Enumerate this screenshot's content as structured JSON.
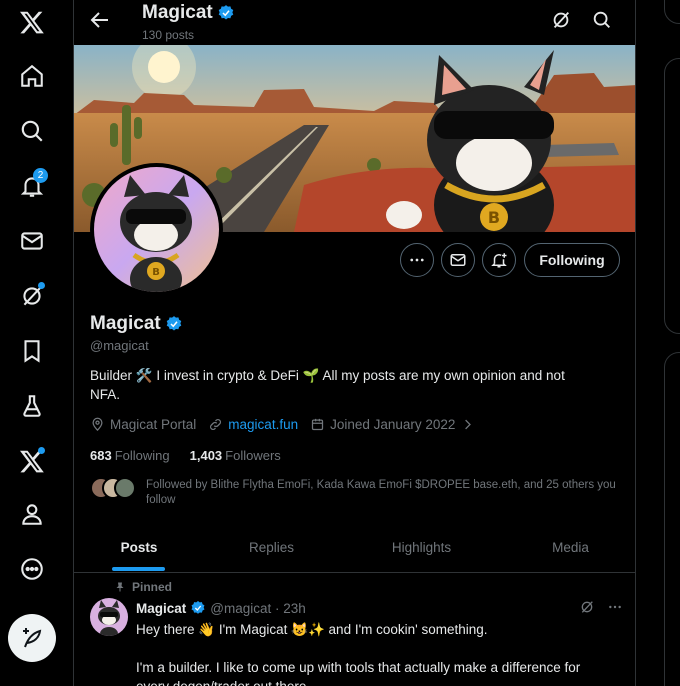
{
  "nav": {
    "notifications_badge": "2"
  },
  "header": {
    "name": "Magicat",
    "post_count": "130 posts"
  },
  "profile": {
    "name": "Magicat",
    "handle": "@magicat",
    "bio_line1": "Builder 🛠️ I invest in crypto & DeFi 🌱 All my posts are my own opinion and not",
    "bio_line2": "NFA.",
    "location": "Magicat Portal",
    "website": "magicat.fun",
    "joined": "Joined January 2022",
    "following_count": "683",
    "following_label": "Following",
    "followers_count": "1,403",
    "followers_label": "Followers",
    "followed_by": "Followed by Blithe Flytha EmoFi, Kada Kawa EmoFi $DROPEE base.eth, and 25 others you follow",
    "follow_button": "Following"
  },
  "tabs": [
    "Posts",
    "Replies",
    "Highlights",
    "Media"
  ],
  "pinned_post": {
    "pinned_label": "Pinned",
    "author": "Magicat",
    "handle_time": "@magicat · 23h",
    "line1": "Hey there 👋 I'm Magicat 😺✨ and I'm cookin' something.",
    "line2": "I'm a builder. I like to come up with tools that actually make a difference for",
    "line3": "every degen/trader out there."
  },
  "colors": {
    "accent": "#1d9bf0",
    "background": "#000000",
    "border": "#2f3336",
    "muted_text": "#71767b"
  }
}
